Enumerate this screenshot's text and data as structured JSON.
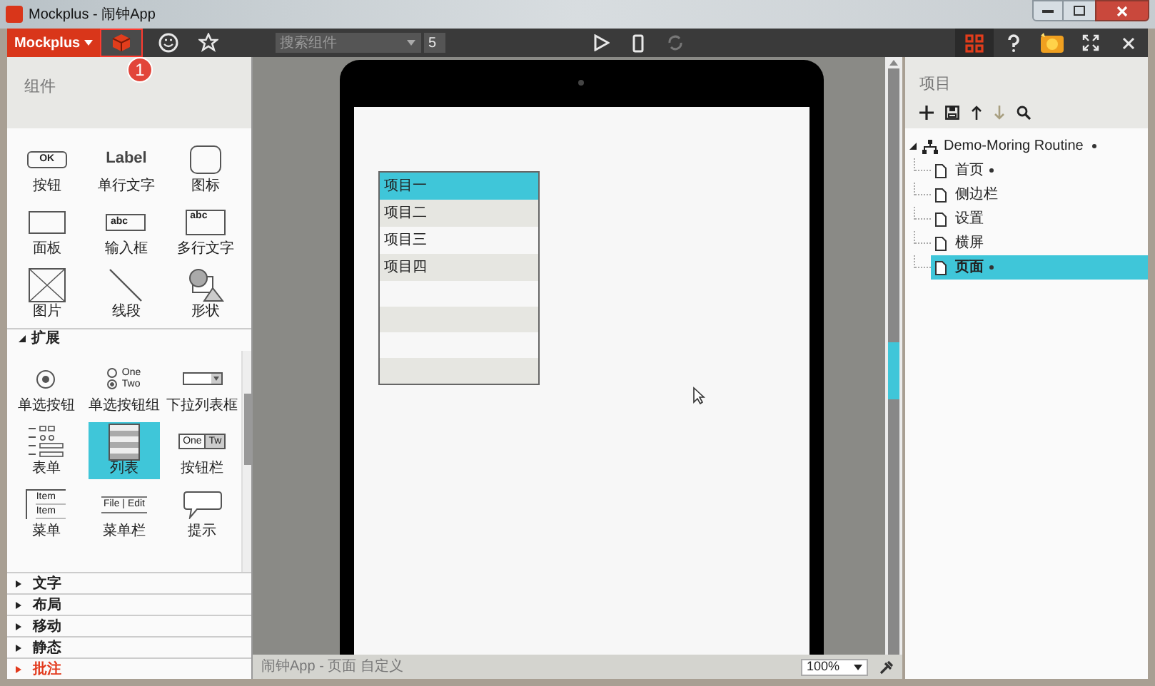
{
  "window": {
    "title": "Mockplus - 闹钟App"
  },
  "toolbar": {
    "brand_menu": "Mockplus",
    "left_tools": [
      {
        "kind": "cube",
        "selected": true
      },
      {
        "kind": "smiley",
        "selected": false
      },
      {
        "kind": "star",
        "selected": false
      }
    ],
    "callout": "1",
    "search": {
      "placeholder": "搜索组件"
    },
    "page_count": "5",
    "center_tools": [
      {
        "kind": "play",
        "disabled": false
      },
      {
        "kind": "phone",
        "disabled": false
      },
      {
        "kind": "rotate",
        "disabled": true
      }
    ],
    "right_tools": [
      {
        "kind": "grid",
        "selected": true
      },
      {
        "kind": "help",
        "selected": false
      },
      {
        "kind": "avatar",
        "selected": false
      },
      {
        "kind": "fullscreen",
        "selected": false
      },
      {
        "kind": "close",
        "selected": false
      }
    ]
  },
  "components_panel": {
    "title": "组件",
    "basic": [
      {
        "kind": "button",
        "label": "按钮",
        "preview_text": [
          "OK"
        ]
      },
      {
        "kind": "label",
        "label": "单行文字",
        "preview_text": [
          "Label"
        ]
      },
      {
        "kind": "icon",
        "label": "图标"
      },
      {
        "kind": "panel",
        "label": "面板"
      },
      {
        "kind": "input",
        "label": "输入框",
        "preview_text": [
          "abc"
        ]
      },
      {
        "kind": "textarea",
        "label": "多行文字",
        "preview_text": [
          "abc"
        ]
      },
      {
        "kind": "image",
        "label": "图片"
      },
      {
        "kind": "line",
        "label": "线段"
      },
      {
        "kind": "shape",
        "label": "形状"
      }
    ],
    "expanded_section": {
      "label": "扩展",
      "expanded": true,
      "items": [
        {
          "kind": "radio",
          "label": "单选按钮",
          "selected": false
        },
        {
          "kind": "radio-group",
          "label": "单选按钮组",
          "selected": false,
          "preview_text": [
            "One",
            "Two"
          ]
        },
        {
          "kind": "dropdown",
          "label": "下拉列表框",
          "selected": false
        },
        {
          "kind": "form",
          "label": "表单",
          "selected": false
        },
        {
          "kind": "list",
          "label": "列表",
          "selected": true
        },
        {
          "kind": "button-bar",
          "label": "按钮栏",
          "selected": false,
          "preview_text": [
            "One",
            "Tw"
          ]
        },
        {
          "kind": "menu",
          "label": "菜单",
          "selected": false,
          "preview_text": [
            "Item",
            "Item"
          ]
        },
        {
          "kind": "menubar",
          "label": "菜单栏",
          "selected": false,
          "preview_text": [
            "File | Edit"
          ]
        },
        {
          "kind": "tooltip",
          "label": "提示",
          "selected": false
        }
      ]
    },
    "collapsed_sections": [
      {
        "label": "文字",
        "highlighted": false
      },
      {
        "label": "布局",
        "highlighted": false
      },
      {
        "label": "移动",
        "highlighted": false
      },
      {
        "label": "静态",
        "highlighted": false
      },
      {
        "label": "批注",
        "highlighted": true
      }
    ]
  },
  "canvas": {
    "list_items": [
      {
        "label": "项目一",
        "selected": true
      },
      {
        "label": "项目二",
        "selected": false
      },
      {
        "label": "项目三",
        "selected": false
      },
      {
        "label": "项目四",
        "selected": false
      }
    ]
  },
  "project_panel": {
    "title": "项目",
    "tree": {
      "label": "Demo-Moring Routine",
      "modified": true,
      "expanded": true,
      "children": [
        {
          "label": "首页",
          "modified": true,
          "selected": false
        },
        {
          "label": "侧边栏",
          "modified": false,
          "selected": false
        },
        {
          "label": "设置",
          "modified": false,
          "selected": false
        },
        {
          "label": "横屏",
          "modified": false,
          "selected": false
        },
        {
          "label": "页面",
          "modified": true,
          "selected": true
        }
      ]
    }
  },
  "status_bar": {
    "text": "闹钟App - 页面 自定义",
    "zoom": "100%"
  }
}
